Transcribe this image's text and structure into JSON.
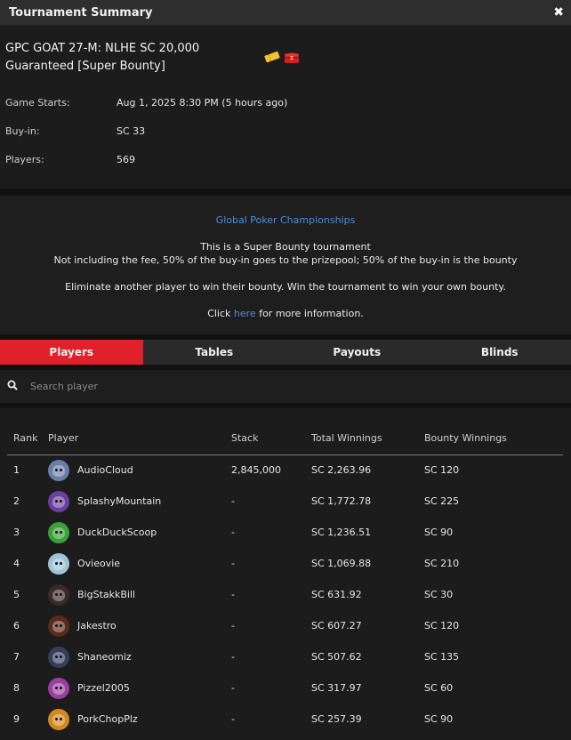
{
  "window": {
    "title": "Tournament Summary",
    "close_icon": "close-icon"
  },
  "tournament": {
    "name": "GPC GOAT 27-M: NLHE SC 20,000 Guaranteed [Super Bounty]",
    "badges": [
      "ticket-icon",
      "bounty-chest-icon"
    ],
    "details": [
      {
        "label": "Game Starts:",
        "value": "Aug 1, 2025 8:30 PM (5 hours ago)"
      },
      {
        "label": "Buy-in:",
        "value": "SC 33"
      },
      {
        "label": "Players:",
        "value": "569"
      }
    ]
  },
  "description": {
    "series_link": "Global Poker Championships",
    "line1": "This is a Super Bounty tournament",
    "line2": "Not including the fee, 50% of the buy-in goes to the prizepool; 50% of the buy-in is the bounty",
    "line3": "Eliminate another player to win their bounty. Win the tournament to win your own bounty.",
    "click_prefix": "Click",
    "click_link": "here",
    "click_suffix": "for more information."
  },
  "tabs": [
    {
      "label": "Players",
      "active": true
    },
    {
      "label": "Tables",
      "active": false
    },
    {
      "label": "Payouts",
      "active": false
    },
    {
      "label": "Blinds",
      "active": false
    }
  ],
  "search": {
    "icon": "search-icon",
    "placeholder": "Search player"
  },
  "table": {
    "headers": [
      "Rank",
      "Player",
      "Stack",
      "Total Winnings",
      "Bounty Winnings"
    ],
    "rows": [
      {
        "rank": "1",
        "player": "AudioCloud",
        "stack": "2,845,000",
        "total": "SC 2,263.96",
        "bounty": "SC 120",
        "avatar_color": "#6a7fa8"
      },
      {
        "rank": "2",
        "player": "SplashyMountain",
        "stack": "-",
        "total": "SC 1,772.78",
        "bounty": "SC 225",
        "avatar_color": "#6b3fa0"
      },
      {
        "rank": "3",
        "player": "DuckDuckScoop",
        "stack": "-",
        "total": "SC 1,236.51",
        "bounty": "SC 90",
        "avatar_color": "#3aa03a"
      },
      {
        "rank": "4",
        "player": "Ovieovie",
        "stack": "-",
        "total": "SC 1,069.88",
        "bounty": "SC 210",
        "avatar_color": "#9fc4d6"
      },
      {
        "rank": "5",
        "player": "BigStakkBill",
        "stack": "-",
        "total": "SC 631.92",
        "bounty": "SC 30",
        "avatar_color": "#3a2a2a"
      },
      {
        "rank": "6",
        "player": "Jakestro",
        "stack": "-",
        "total": "SC 607.27",
        "bounty": "SC 120",
        "avatar_color": "#5a2a1a"
      },
      {
        "rank": "7",
        "player": "Shaneomiz",
        "stack": "-",
        "total": "SC 507.62",
        "bounty": "SC 135",
        "avatar_color": "#34405a"
      },
      {
        "rank": "8",
        "player": "Pizzel2005",
        "stack": "-",
        "total": "SC 317.97",
        "bounty": "SC 60",
        "avatar_color": "#9a3fa0"
      },
      {
        "rank": "9",
        "player": "PorkChopPlz",
        "stack": "-",
        "total": "SC 257.39",
        "bounty": "SC 90",
        "avatar_color": "#d08a20"
      }
    ]
  },
  "colors": {
    "accent": "#e0202a",
    "link": "#4a90d9"
  }
}
